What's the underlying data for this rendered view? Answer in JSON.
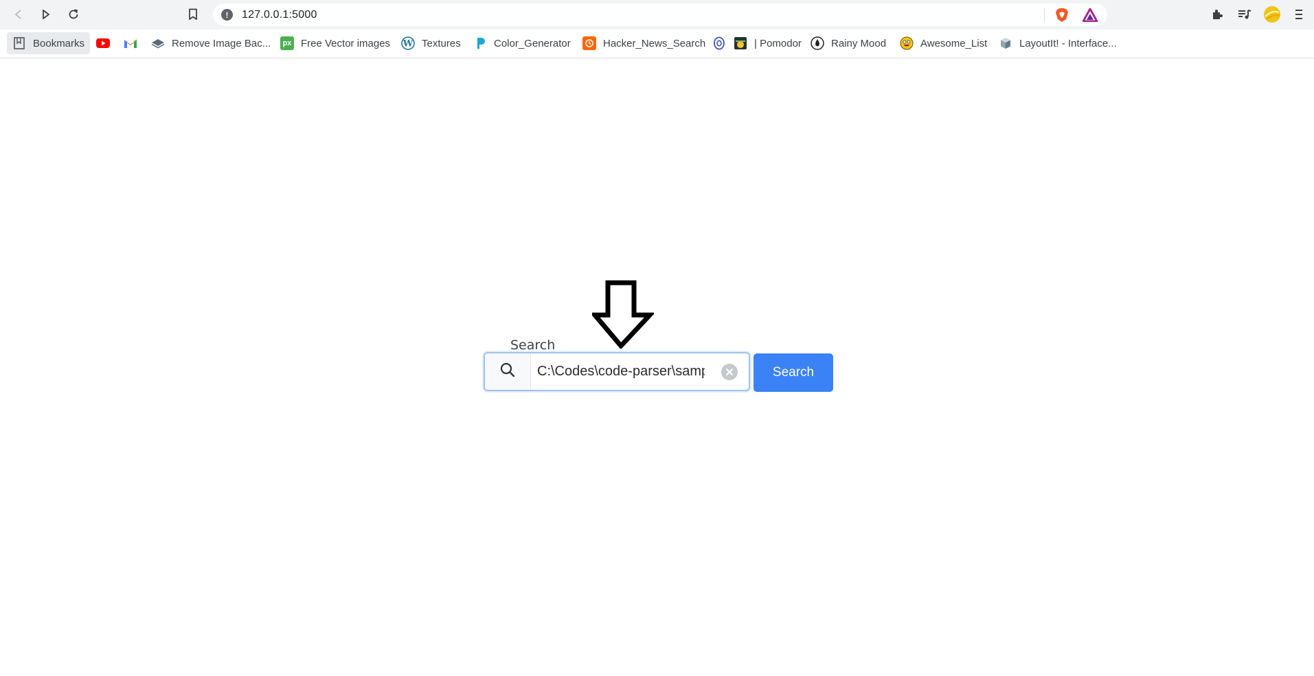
{
  "browser": {
    "url": "127.0.0.1:5000",
    "back_icon": "back-arrow-icon",
    "forward_icon": "forward-arrow-icon",
    "reload_icon": "reload-icon",
    "bookmark_icon": "bookmark-icon"
  },
  "bookmarks": [
    {
      "label": "Bookmarks",
      "icon": "bookmarks-folder-icon"
    },
    {
      "label": "",
      "icon": "youtube-icon"
    },
    {
      "label": "",
      "icon": "gmail-icon"
    },
    {
      "label": "Remove Image Bac...",
      "icon": "layers-icon"
    },
    {
      "label": "Free Vector images",
      "icon": "px-icon"
    },
    {
      "label": "Textures",
      "icon": "wordpress-icon"
    },
    {
      "label": "Color_Generator",
      "icon": "drop-icon"
    },
    {
      "label": "Hacker_News_Search",
      "icon": "clock-icon"
    },
    {
      "label": "",
      "icon": "target-icon"
    },
    {
      "label": "| Pomodor",
      "icon": "tomato-icon"
    },
    {
      "label": "Rainy Mood",
      "icon": "raindrop-icon"
    },
    {
      "label": "Awesome_List",
      "icon": "emoji-icon"
    },
    {
      "label": "LayoutIt! - Interface...",
      "icon": "cube-icon"
    }
  ],
  "search": {
    "label": "Search",
    "input_value": "C:\\Codes\\code-parser\\samp",
    "button_label": "Search"
  },
  "colors": {
    "accent": "#3b82f6",
    "toolbar_bg": "#f1f3f4"
  }
}
